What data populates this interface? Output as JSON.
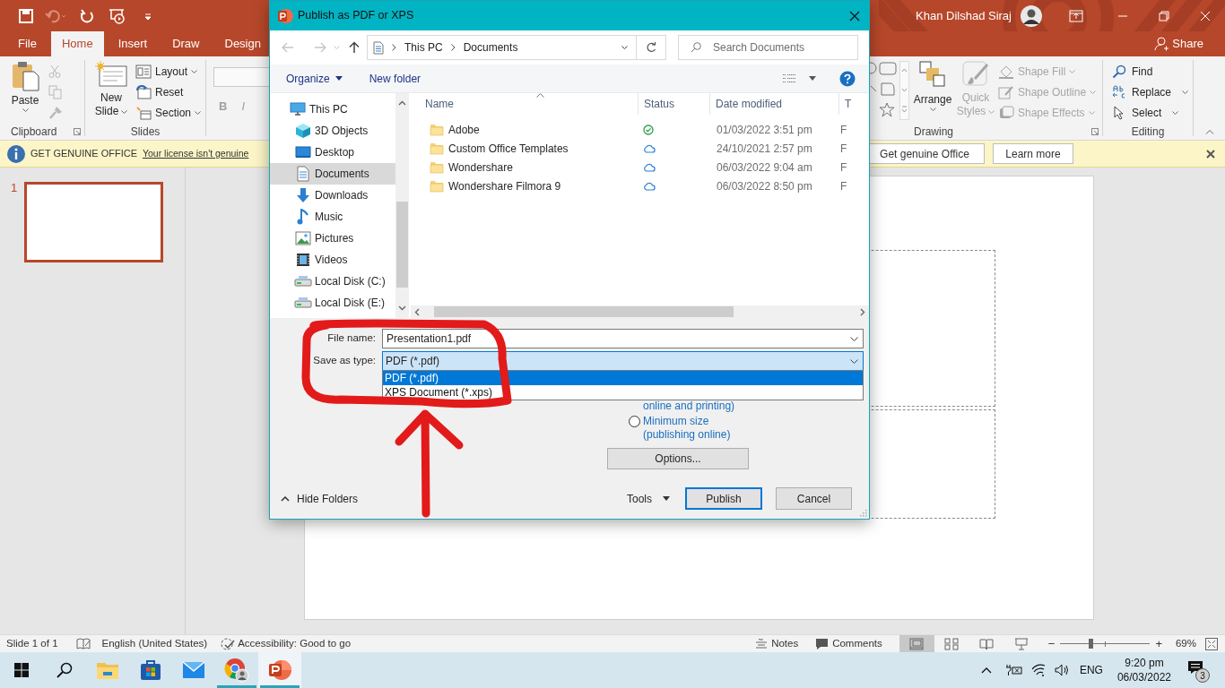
{
  "app": {
    "user_name": "Khan Dilshad Siraj",
    "share": "Share"
  },
  "quick_access": [
    {
      "kind": "save",
      "disabled": false
    },
    {
      "kind": "undo",
      "disabled": true
    },
    {
      "kind": "repeat",
      "disabled": false
    },
    {
      "kind": "present",
      "disabled": false
    },
    {
      "kind": "customize",
      "disabled": false
    }
  ],
  "ribbon_tabs": [
    {
      "label": "File",
      "selected": false
    },
    {
      "label": "Home",
      "selected": true
    },
    {
      "label": "Insert",
      "selected": false
    },
    {
      "label": "Draw",
      "selected": false
    },
    {
      "label": "Design",
      "selected": false
    }
  ],
  "clipboard": {
    "paste": "Paste",
    "label": "Clipboard",
    "tools": [
      {
        "kind": "cut",
        "disabled": true
      },
      {
        "kind": "copy",
        "disabled": true
      },
      {
        "kind": "painter",
        "disabled": true
      }
    ]
  },
  "slides": {
    "new_slide": [
      "New",
      "Slide"
    ],
    "commands": [
      {
        "label": "Layout",
        "has_menu": true
      },
      {
        "label": "Reset",
        "has_menu": false
      },
      {
        "label": "Section",
        "has_menu": true
      }
    ],
    "label": "Slides"
  },
  "font": {
    "buttons": [
      "B",
      "I"
    ]
  },
  "drawing": {
    "arrange": "Arrange",
    "quick_styles": {
      "lines": [
        "Quick",
        "Styles"
      ],
      "disabled": true
    },
    "commands": [
      {
        "label": "Shape Fill",
        "disabled": true
      },
      {
        "label": "Shape Outline",
        "disabled": true
      },
      {
        "label": "Shape Effects",
        "disabled": true
      }
    ],
    "label": "Drawing"
  },
  "editing": {
    "commands": [
      {
        "label": "Find",
        "has_menu": false
      },
      {
        "label": "Replace",
        "has_menu": true
      },
      {
        "label": "Select",
        "has_menu": true
      }
    ],
    "label": "Editing"
  },
  "info_bar": {
    "title": "GET GENUINE OFFICE",
    "link": "Your license isn't genuine",
    "buttons": [
      "Get genuine Office",
      "Learn more"
    ]
  },
  "thumbnails": [
    {
      "number": "1",
      "selected": true
    }
  ],
  "dialog": {
    "title": "Publish as PDF or XPS",
    "path": [
      "This PC",
      "Documents"
    ],
    "search_placeholder": "Search Documents",
    "organize": "Organize",
    "new_folder": "New folder",
    "nav": [
      {
        "label": "This PC",
        "kind": "pc",
        "selected": false,
        "children": [
          {
            "label": "3D Objects",
            "kind": "cube",
            "selected": false
          },
          {
            "label": "Desktop",
            "kind": "desktop",
            "selected": false
          },
          {
            "label": "Documents",
            "kind": "documents",
            "selected": true
          },
          {
            "label": "Downloads",
            "kind": "downloads",
            "selected": false
          },
          {
            "label": "Music",
            "kind": "music",
            "selected": false
          },
          {
            "label": "Pictures",
            "kind": "pictures",
            "selected": false
          },
          {
            "label": "Videos",
            "kind": "videos",
            "selected": false
          },
          {
            "label": "Local Disk (C:)",
            "kind": "disk",
            "selected": false
          },
          {
            "label": "Local Disk (E:)",
            "kind": "disk",
            "selected": false
          }
        ]
      }
    ],
    "columns": [
      "Name",
      "Status",
      "Date modified",
      "T"
    ],
    "files": [
      {
        "name": "Adobe",
        "kind": "synced",
        "date": "01/03/2022 3:51 pm",
        "column_4": "F"
      },
      {
        "name": "Custom Office Templates",
        "kind": "cloud",
        "date": "24/10/2021 2:57 pm",
        "column_4": "F"
      },
      {
        "name": "Wondershare",
        "kind": "cloud",
        "date": "06/03/2022 9:04 am",
        "column_4": "F"
      },
      {
        "name": "Wondershare Filmora 9",
        "kind": "cloud",
        "date": "06/03/2022 8:50 pm",
        "column_4": "F"
      }
    ],
    "file_name_label": "File name:",
    "file_name": "Presentation1.pdf",
    "save_as_type_label": "Save as type:",
    "save_as_type": "PDF (*.pdf)",
    "type_options": [
      {
        "label": "PDF (*.pdf)",
        "selected": true
      },
      {
        "label": "XPS Document (*.xps)",
        "selected": false
      }
    ],
    "standard_option_tail": "online and printing)",
    "minimum_option": {
      "lines": [
        "Minimum size",
        "(publishing online)"
      ],
      "selected": false
    },
    "options": "Options...",
    "hide_folders": "Hide Folders",
    "tools": "Tools",
    "publish": "Publish",
    "cancel": "Cancel"
  },
  "status_bar": {
    "slide": "Slide 1 of 1",
    "language": "English (United States)",
    "accessibility": "Accessibility: Good to go",
    "notes": "Notes",
    "comments": "Comments",
    "views": [
      {
        "kind": "normal",
        "selected": true
      },
      {
        "kind": "sorter",
        "selected": false
      },
      {
        "kind": "reading",
        "selected": false
      },
      {
        "kind": "show",
        "selected": false
      }
    ],
    "zoom": {
      "level": 0.34,
      "label": "69%",
      "out": "−",
      "in": "+"
    }
  },
  "taskbar": {
    "apps": [
      {
        "kind": "explorer",
        "running": false,
        "selected": false
      },
      {
        "kind": "store",
        "running": false,
        "selected": false
      },
      {
        "kind": "mail",
        "running": false,
        "selected": false
      },
      {
        "kind": "chrome",
        "running": true,
        "selected": false
      },
      {
        "kind": "powerpoint",
        "running": true,
        "selected": true
      }
    ],
    "language": "ENG",
    "time": "9:20 pm",
    "date": "06/03/2022",
    "notifications": "3"
  }
}
